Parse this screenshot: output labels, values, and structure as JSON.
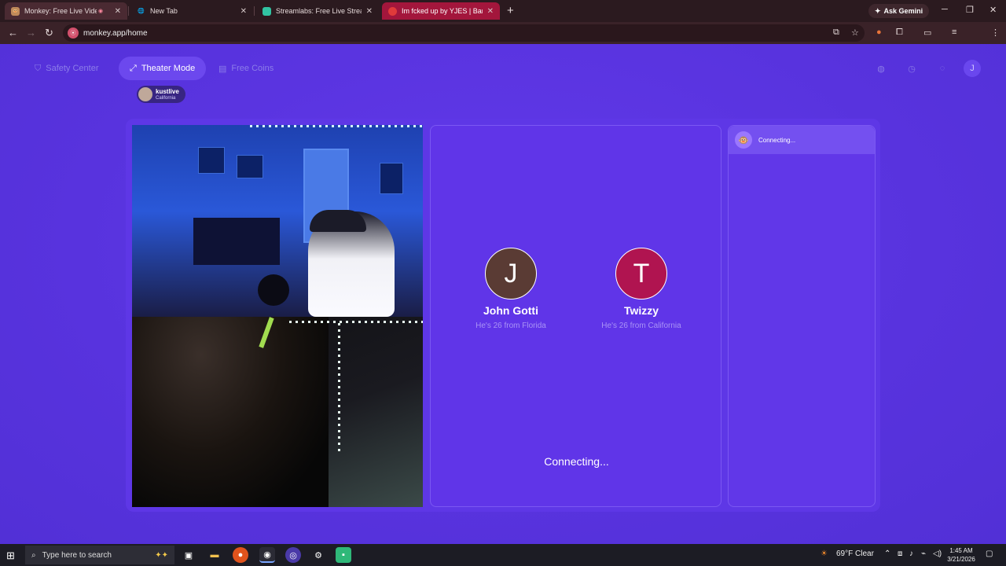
{
  "browser": {
    "tabs": [
      {
        "title": "Monkey: Free Live Video Ch",
        "active": true
      },
      {
        "title": "New Tab",
        "active": false
      },
      {
        "title": "Streamlabs: Free Live Streaming",
        "active": false
      },
      {
        "title": "Im fcked up by YJES | BandLab",
        "active": false
      }
    ],
    "ask_gemini": "Ask Gemini",
    "url": "monkey.app/home",
    "profile_initial": "J"
  },
  "page": {
    "nav": {
      "safety": "Safety Center",
      "theater": "Theater Mode",
      "coins": "Free Coins",
      "user_initial": "J"
    },
    "local_user": {
      "name": "kustlive",
      "location": "California"
    },
    "matches": [
      {
        "initial": "J",
        "name": "John Gotti",
        "sub": "He's 26 from Florida",
        "color": "#5a3b34"
      },
      {
        "initial": "T",
        "name": "Twizzy",
        "sub": "He's 26 from California",
        "color": "#b01450"
      }
    ],
    "status": "Connecting...",
    "chat_header": "Connecting..."
  },
  "taskbar": {
    "search_placeholder": "Type here to search",
    "weather": "69°F  Clear",
    "time": "1:45 AM",
    "date": "3/21/2026"
  },
  "colors": {
    "accent": "#5b34e0",
    "panel": "#6035e8"
  }
}
